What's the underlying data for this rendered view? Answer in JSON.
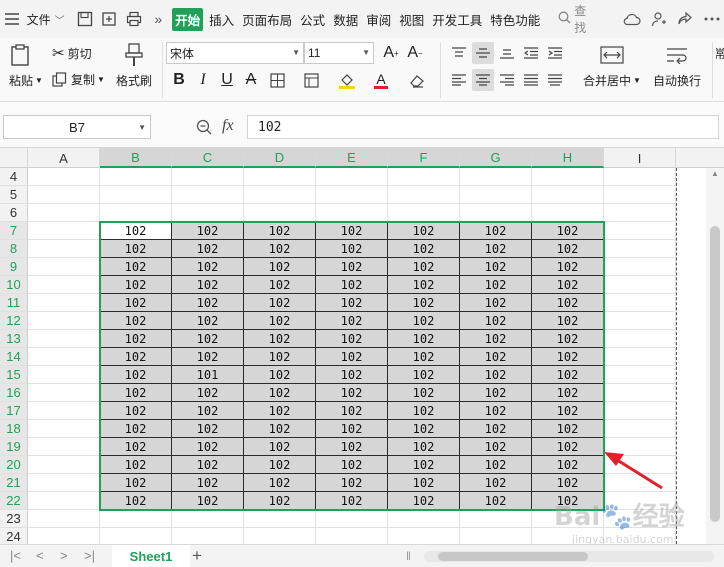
{
  "menubar": {
    "file": "文件",
    "more": "»",
    "tabs": [
      {
        "label": "开始",
        "active": true
      },
      {
        "label": "插入",
        "active": false
      },
      {
        "label": "页面布局",
        "active": false
      },
      {
        "label": "公式",
        "active": false
      },
      {
        "label": "数据",
        "active": false
      },
      {
        "label": "审阅",
        "active": false
      },
      {
        "label": "视图",
        "active": false
      },
      {
        "label": "开发工具",
        "active": false
      },
      {
        "label": "特色功能",
        "active": false
      }
    ],
    "search": "查找"
  },
  "ribbon": {
    "paste": "粘贴",
    "cut": "剪切",
    "copy": "复制",
    "format_painter": "格式刷",
    "font_name": "宋体",
    "font_size": "11",
    "merge_center": "合并居中",
    "wrap_text": "自动换行",
    "partial": "常"
  },
  "formula_bar": {
    "name_box": "B7",
    "fx": "fx",
    "value": "102"
  },
  "grid": {
    "row_header_label": "",
    "columns": [
      "A",
      "B",
      "C",
      "D",
      "E",
      "F",
      "G",
      "H",
      "I"
    ],
    "selected_columns": [
      "B",
      "C",
      "D",
      "E",
      "F",
      "G",
      "H"
    ],
    "rows": [
      "4",
      "5",
      "6",
      "7",
      "8",
      "9",
      "10",
      "11",
      "12",
      "13",
      "14",
      "15",
      "16",
      "17",
      "18",
      "19",
      "20",
      "21",
      "22",
      "23",
      "24"
    ],
    "selected_rows": [
      "7",
      "8",
      "9",
      "10",
      "11",
      "12",
      "13",
      "14",
      "15",
      "16",
      "17",
      "18",
      "19",
      "20",
      "21",
      "22"
    ],
    "active_cell": "B7",
    "data_rows": [
      [
        "102",
        "102",
        "102",
        "102",
        "102",
        "102",
        "102"
      ],
      [
        "102",
        "102",
        "102",
        "102",
        "102",
        "102",
        "102"
      ],
      [
        "102",
        "102",
        "102",
        "102",
        "102",
        "102",
        "102"
      ],
      [
        "102",
        "102",
        "102",
        "102",
        "102",
        "102",
        "102"
      ],
      [
        "102",
        "102",
        "102",
        "102",
        "102",
        "102",
        "102"
      ],
      [
        "102",
        "102",
        "102",
        "102",
        "102",
        "102",
        "102"
      ],
      [
        "102",
        "102",
        "102",
        "102",
        "102",
        "102",
        "102"
      ],
      [
        "102",
        "102",
        "102",
        "102",
        "102",
        "102",
        "102"
      ],
      [
        "102",
        "101",
        "102",
        "102",
        "102",
        "102",
        "102"
      ],
      [
        "102",
        "102",
        "102",
        "102",
        "102",
        "102",
        "102"
      ],
      [
        "102",
        "102",
        "102",
        "102",
        "102",
        "102",
        "102"
      ],
      [
        "102",
        "102",
        "102",
        "102",
        "102",
        "102",
        "102"
      ],
      [
        "102",
        "102",
        "102",
        "102",
        "102",
        "102",
        "102"
      ],
      [
        "102",
        "102",
        "102",
        "102",
        "102",
        "102",
        "102"
      ],
      [
        "102",
        "102",
        "102",
        "102",
        "102",
        "102",
        "102"
      ],
      [
        "102",
        "102",
        "102",
        "102",
        "102",
        "102",
        "102"
      ]
    ]
  },
  "sheets": {
    "tabs": [
      "Sheet1"
    ],
    "add": "+"
  },
  "watermark": {
    "main": "Bai",
    "suffix": "经验",
    "url": "jingyan.baidu.com"
  },
  "colors": {
    "accent": "#1fa15a",
    "selection_fill": "#d6d6d6",
    "arrow": "#e3202a"
  }
}
